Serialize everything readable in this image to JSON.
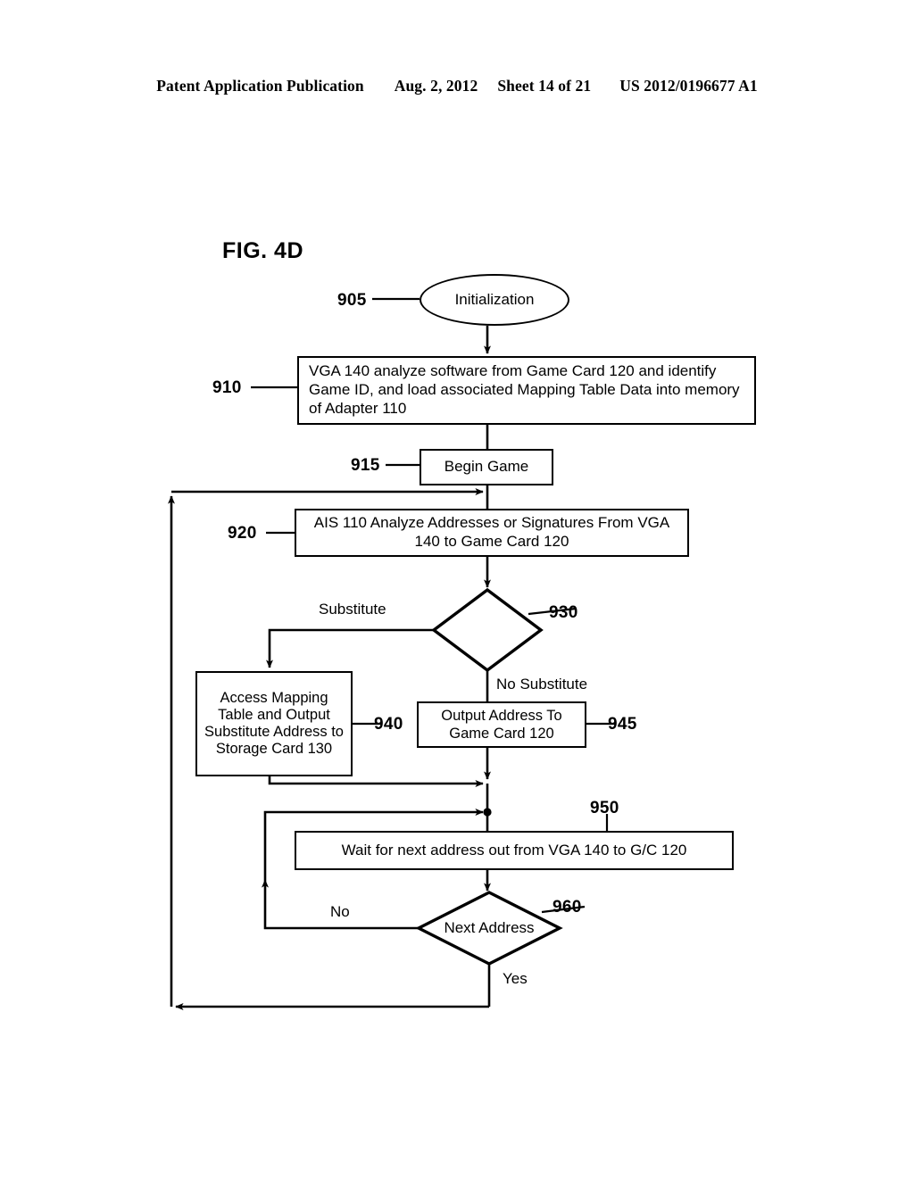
{
  "header": {
    "publication": "Patent Application Publication",
    "date": "Aug. 2, 2012",
    "sheet": "Sheet 14 of 21",
    "docnum": "US 2012/0196677 A1"
  },
  "figure": {
    "title": "FIG. 4D"
  },
  "nodes": {
    "n905": {
      "ref": "905",
      "label": "Initialization",
      "shape": "oval"
    },
    "n910": {
      "ref": "910",
      "label": "VGA 140 analyze software from Game Card 120 and identify Game ID, and load associated Mapping Table Data into memory of Adapter 110",
      "shape": "box"
    },
    "n915": {
      "ref": "915",
      "label": "Begin Game",
      "shape": "box"
    },
    "n920": {
      "ref": "920",
      "label": "AIS 110 Analyze Addresses or Signatures From VGA 140 to Game Card 120",
      "shape": "box"
    },
    "n930": {
      "ref": "930",
      "label": "",
      "shape": "diamond"
    },
    "n940": {
      "ref": "940",
      "label": "Access Mapping Table and Output Substitute Address to Storage Card 130",
      "shape": "box"
    },
    "n945": {
      "ref": "945",
      "label": "Output Address To Game Card 120",
      "shape": "box"
    },
    "n950": {
      "ref": "950",
      "label": "Wait for next address out from VGA 140 to G/C 120",
      "shape": "box"
    },
    "n960": {
      "ref": "960",
      "label": "Next Address",
      "shape": "diamond"
    }
  },
  "edge_labels": {
    "substitute": "Substitute",
    "no_substitute": "No Substitute",
    "no": "No",
    "yes": "Yes"
  },
  "colors": {
    "ink": "#000000",
    "paper": "#ffffff"
  }
}
